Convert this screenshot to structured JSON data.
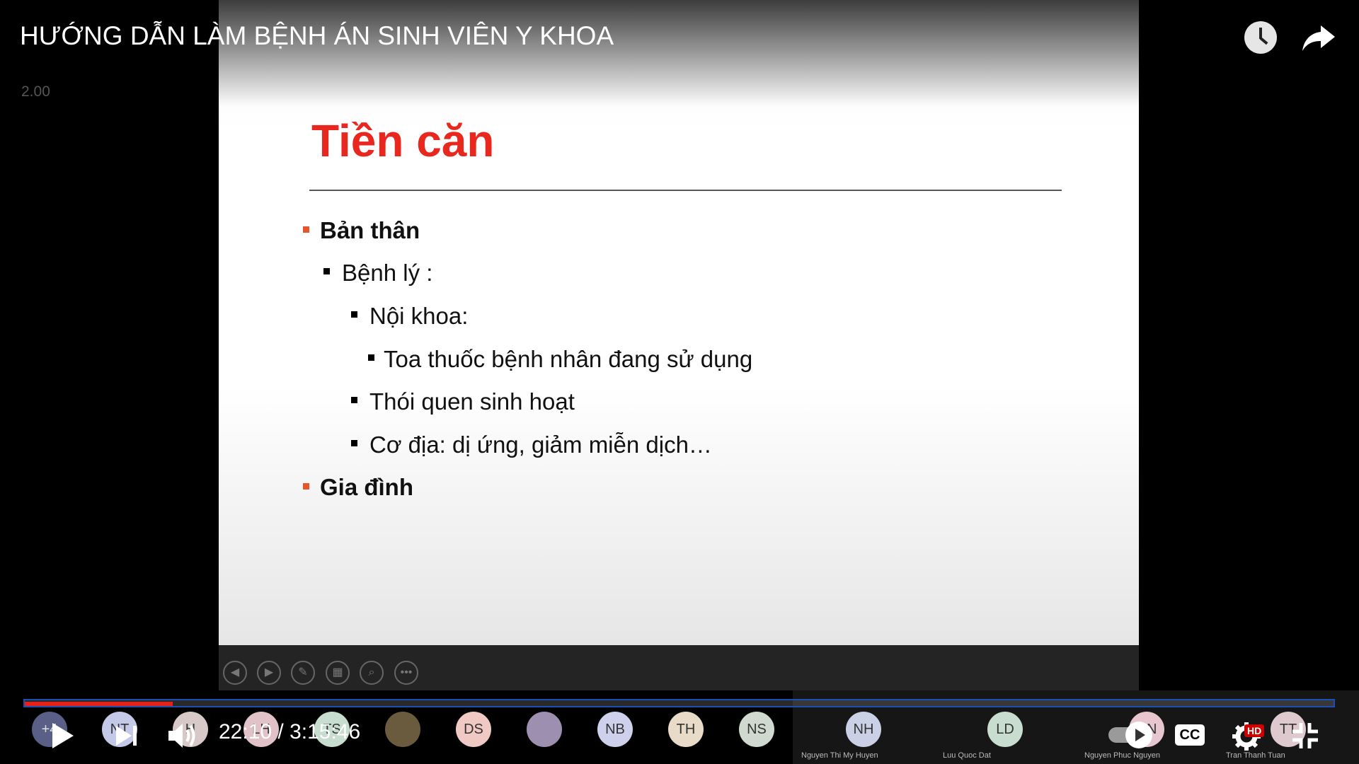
{
  "player": {
    "title": "HƯỚNG DẪN LÀM BỆNH ÁN SINH VIÊN Y KHOA",
    "speed": "2.00",
    "current_time": "22:10",
    "duration": "3:15:46",
    "time_display": "22:10 / 3:15:46",
    "progress_fraction": 0.113,
    "hd_badge": "HD",
    "cc_label": "CC",
    "icons": [
      "watch-later-icon",
      "share-icon",
      "play-icon",
      "next-icon",
      "volume-icon",
      "autoplay-toggle",
      "cc-icon",
      "settings-icon",
      "exit-fullscreen-icon"
    ]
  },
  "slide": {
    "title": "Tiền căn",
    "bullets": [
      {
        "level": 0,
        "text": "Bản thân"
      },
      {
        "level": 1,
        "text": "Bệnh lý :"
      },
      {
        "level": 2,
        "text": "Nội khoa:"
      },
      {
        "level": 3,
        "text": "Toa thuốc bệnh nhân đang sử dụng"
      },
      {
        "level": 2,
        "text": "Thói quen sinh hoạt"
      },
      {
        "level": 2,
        "text": "Cơ địa: dị ứng, giảm miễn dịch…"
      },
      {
        "level": 0,
        "text": "Gia đình"
      }
    ]
  },
  "participants": {
    "overflow": "+4",
    "avatars": [
      {
        "initials": "NT",
        "color": "#c5c9e8"
      },
      {
        "initials": "H",
        "color": "#d8c9c9"
      },
      {
        "initials": "LH",
        "color": "#e0c2c8"
      },
      {
        "initials": "TS",
        "color": "#c7ddd0"
      },
      {
        "initials": "",
        "color": "#6b5b3e"
      },
      {
        "initials": "DS",
        "color": "#f0c8c4"
      },
      {
        "initials": "",
        "color": "#9d8fb0"
      },
      {
        "initials": "NB",
        "color": "#cfd1ec"
      },
      {
        "initials": "TH",
        "color": "#e8dcc8"
      },
      {
        "initials": "NS",
        "color": "#cfd9cf"
      },
      {
        "initials": "NH",
        "color": "#cad1e6"
      },
      {
        "initials": "LD",
        "color": "#c8dccf"
      },
      {
        "initials": "NN",
        "color": "#e7c6cf"
      },
      {
        "initials": "TT",
        "color": "#dec9cf"
      }
    ],
    "names": [
      "Nguyen Thi My Huyen",
      "Luu Quoc Dat",
      "Nguyen Phuc Nguyen",
      "Tran Thanh Tuan"
    ]
  },
  "colors": {
    "progress": "#e62117",
    "slide_title": "#e8281e",
    "slide_bullet_l0": "#e4572e"
  }
}
